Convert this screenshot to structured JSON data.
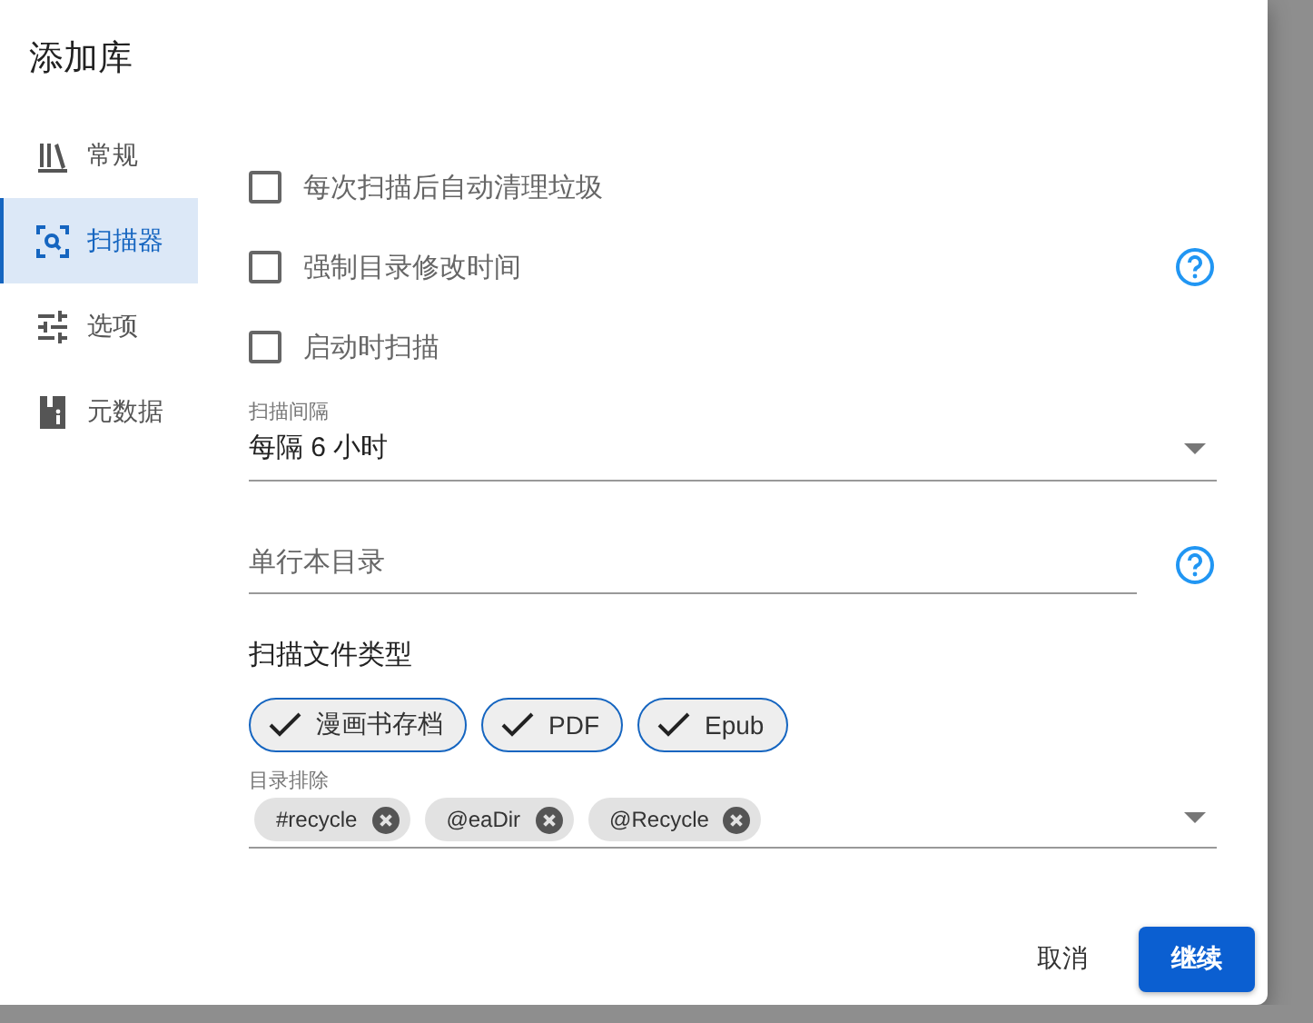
{
  "dialog": {
    "title": "添加库"
  },
  "sidebar": {
    "items": [
      {
        "label": "常规",
        "selected": false
      },
      {
        "label": "扫描器",
        "selected": true
      },
      {
        "label": "选项",
        "selected": false
      },
      {
        "label": "元数据",
        "selected": false
      }
    ]
  },
  "options": [
    {
      "label": "每次扫描后自动清理垃圾",
      "checked": false,
      "help": false
    },
    {
      "label": "强制目录修改时间",
      "checked": false,
      "help": true
    },
    {
      "label": "启动时扫描",
      "checked": false,
      "help": false
    }
  ],
  "scan_interval": {
    "label": "扫描间隔",
    "value": "每隔 6 小时"
  },
  "oneshot_dir": {
    "placeholder": "单行本目录"
  },
  "file_types": {
    "label": "扫描文件类型",
    "chips": [
      {
        "label": "漫画书存档",
        "selected": true
      },
      {
        "label": "PDF",
        "selected": true
      },
      {
        "label": "Epub",
        "selected": true
      }
    ]
  },
  "exclusions": {
    "label": "目录排除",
    "chips": [
      "#recycle",
      "@eaDir",
      "@Recycle"
    ]
  },
  "buttons": {
    "cancel": "取消",
    "confirm": "继续"
  }
}
